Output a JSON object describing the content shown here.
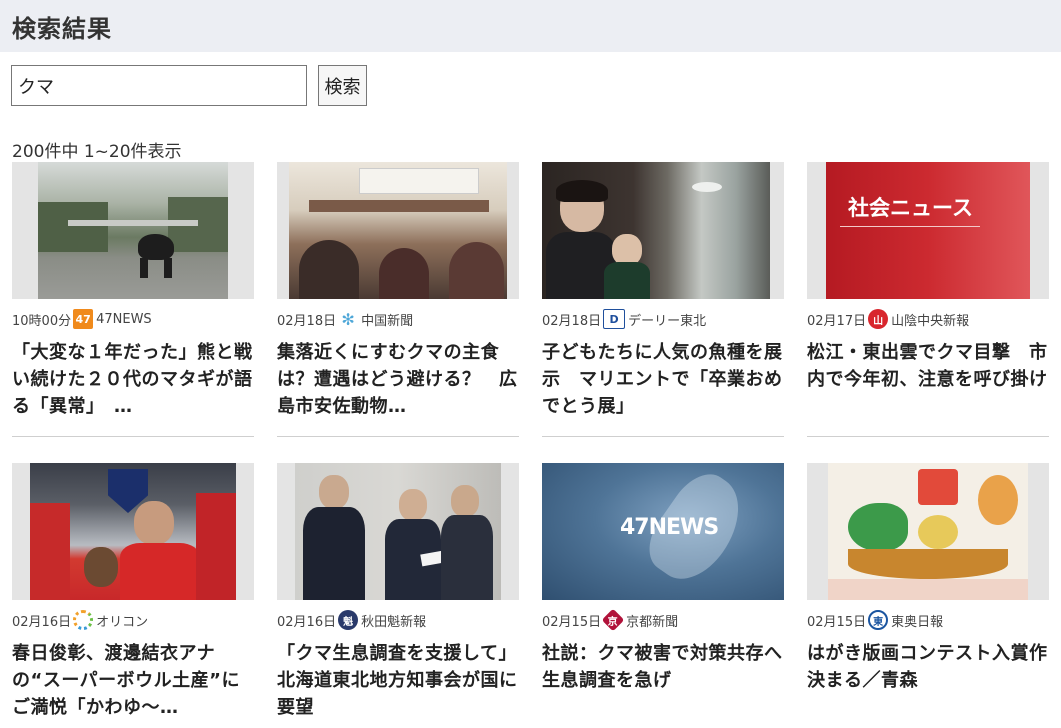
{
  "page": {
    "title": "検索結果"
  },
  "search": {
    "value": "クマ",
    "button_label": "検索"
  },
  "results": {
    "count_text": "200件中 1~20件表示",
    "items": [
      {
        "time": "10時00分",
        "source": "47NEWS",
        "icon": "47news-logo-icon",
        "icon_text": "47",
        "title": "「大変な１年だった」熊と戦い続けた２０代のマタギが語る「異常」　…"
      },
      {
        "time": "02月18日",
        "source": "中国新聞",
        "icon": "chugoku-shimbun-logo-icon",
        "icon_text": "✻",
        "title": "集落近くにすむクマの主食は？遭遇はどう避ける？　広島市安佐動物…"
      },
      {
        "time": "02月18日",
        "source": "デーリー東北",
        "icon": "daily-tohoku-logo-icon",
        "icon_text": "D",
        "title": "子どもたちに人気の魚種を展示　マリエントで「卒業おめでとう展」"
      },
      {
        "time": "02月17日",
        "source": "山陰中央新報",
        "icon": "sanin-chuo-logo-icon",
        "icon_text": "山",
        "title": "松江・東出雲でクマ目撃　市内で今年初、注意を呼び掛け",
        "thumb_text": "社会ニュース"
      },
      {
        "time": "02月16日",
        "source": "オリコン",
        "icon": "oricon-logo-icon",
        "icon_text": "",
        "title": "春日俊彰、渡邊結衣アナの“スーパーボウル土産”にご満悦「かわゆ〜…"
      },
      {
        "time": "02月16日",
        "source": "秋田魁新報",
        "icon": "akita-sakigake-logo-icon",
        "icon_text": "魁",
        "title": "「クマ生息調査を支援して」　北海道東北地方知事会が国に要望"
      },
      {
        "time": "02月15日",
        "source": "京都新聞",
        "icon": "kyoto-shimbun-logo-icon",
        "icon_text": "京",
        "title": "社説：クマ被害で対策共存へ生息調査を急げ",
        "thumb_text": "47NEWS"
      },
      {
        "time": "02月15日",
        "source": "東奥日報",
        "icon": "toonippo-logo-icon",
        "icon_text": "東",
        "title": "はがき版画コンテスト入賞作決まる／青森"
      }
    ]
  },
  "colors": {
    "header_bg": "#eceef3",
    "badge_47": "#f08a1c",
    "chugoku": "#4ea7d8",
    "daily": "#1f4f9c",
    "sanin": "#d8262d",
    "kyoto": "#b1123a",
    "akita": "#2a3a6b",
    "toonippo": "#1b55a0"
  }
}
